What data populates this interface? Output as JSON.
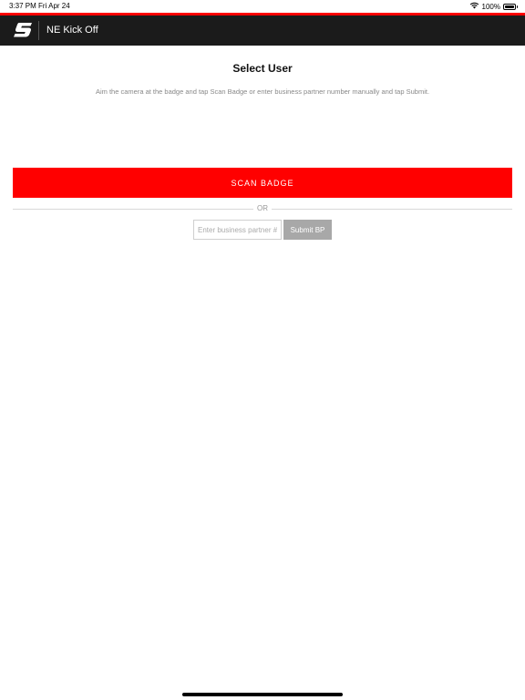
{
  "status_bar": {
    "time": "3:37 PM",
    "date": "Fri Apr 24",
    "battery": "100%",
    "battery_level": 1.0,
    "wifi_icon": "wifi-icon",
    "battery_icon": "battery-icon"
  },
  "header": {
    "title": "NE Kick Off",
    "logo_icon": "brand-logo-icon"
  },
  "main": {
    "title": "Select User",
    "instructions": "Aim the camera at the badge and tap Scan Badge or enter business partner number manually and tap Submit.",
    "scan_button_label": "SCAN BADGE",
    "separator_label": "OR",
    "bp_input": {
      "placeholder": "Enter business partner #",
      "value": ""
    },
    "submit_label": "Submit BP"
  },
  "colors": {
    "accent": "#ff0000",
    "nav_background": "#1b1b1b",
    "submit_disabled": "#a8a8a8"
  }
}
